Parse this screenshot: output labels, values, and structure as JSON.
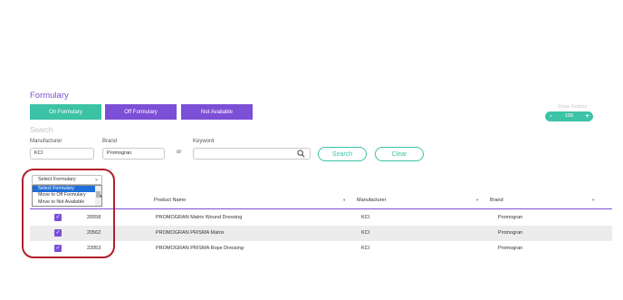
{
  "page": {
    "title": "Formulary"
  },
  "filter_buttons": {
    "on_formulary": "On Formulary",
    "off_formulary": "Off Formulary",
    "not_available": "Not Available"
  },
  "show_entries": {
    "label": "Show Entries",
    "minus": "-",
    "value": "100",
    "plus": "+"
  },
  "search": {
    "heading": "Search",
    "manufacturer_label": "Manufacturer",
    "manufacturer_value": "KCI",
    "brand_label": "Brand",
    "brand_value": "Promogran",
    "or_text": "or",
    "keyword_label": "Keyword",
    "keyword_value": "",
    "search_button": "Search",
    "clear_button": "Clear"
  },
  "formulary_select": {
    "selected": "Select Formulary",
    "options": [
      "Select Formulary",
      "Move to Off Formulary",
      "Move to Not Available"
    ]
  },
  "table": {
    "columns": [
      "Product Name",
      "Manufacturer",
      "Brand"
    ],
    "rows": [
      {
        "checked": true,
        "id": "20558",
        "product_name": "PROMOGRAN Matrix Wound Dressing",
        "manufacturer": "KCI",
        "brand": "Promogran"
      },
      {
        "checked": true,
        "id": "20562",
        "product_name": "PROMOGRAN PRISMA Matrix",
        "manufacturer": "KCI",
        "brand": "Promogran"
      },
      {
        "checked": true,
        "id": "23953",
        "product_name": "PROMOGRAN PRISMA Rope Dressing",
        "manufacturer": "KCI",
        "brand": "Promogran"
      }
    ]
  },
  "colors": {
    "accent_purple": "#7b4fd6",
    "accent_teal": "#3cc3a6",
    "highlight_red": "#b3202a",
    "dropdown_selected": "#1e6fd9"
  }
}
